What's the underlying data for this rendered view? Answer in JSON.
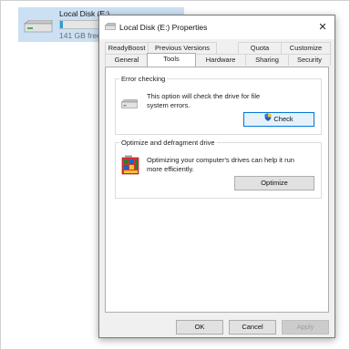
{
  "explorer_item": {
    "name": "Local Disk (E:)",
    "free_space": "141 GB free",
    "usage_fraction": 0.04,
    "icon": "hard-drive-icon"
  },
  "dialog": {
    "title": "Local Disk (E:) Properties",
    "close_label": "✕",
    "tabs_row1": [
      "ReadyBoost",
      "Previous Versions",
      "Quota",
      "Customize"
    ],
    "tabs_row2": [
      "General",
      "Tools",
      "Hardware",
      "Sharing",
      "Security"
    ],
    "active_tab": "Tools",
    "error_checking": {
      "title": "Error checking",
      "description": "This option will check the drive for file system errors.",
      "button_label": "Check",
      "icon": "hard-drive-icon"
    },
    "optimize": {
      "title": "Optimize and defragment drive",
      "description": "Optimizing your computer's drives can help it run more efficiently.",
      "button_label": "Optimize",
      "icon": "defrag-icon"
    },
    "footer": {
      "ok_label": "OK",
      "cancel_label": "Cancel",
      "apply_label": "Apply"
    }
  },
  "colors": {
    "selection_bg": "#cce0f4",
    "usage_fill": "#26a0da",
    "focus_border": "#0078d7"
  }
}
